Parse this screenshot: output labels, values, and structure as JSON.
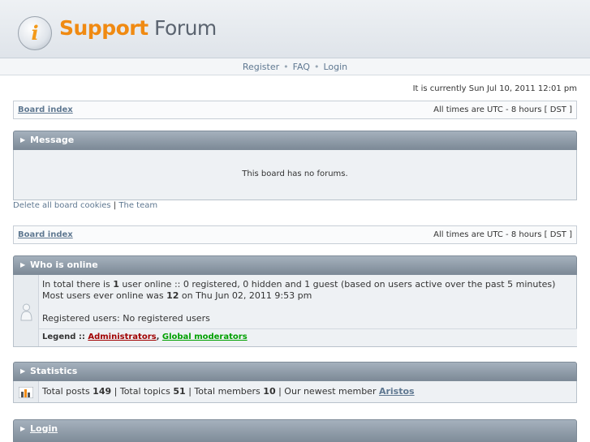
{
  "logo": {
    "icon_letter": "i",
    "name_part1": "Support",
    "name_part2": "Forum"
  },
  "nav": {
    "register": "Register",
    "faq": "FAQ",
    "login": "Login",
    "separator": "•"
  },
  "current_time": "It is currently Sun Jul 10, 2011 12:01 pm",
  "breadcrumb": {
    "board_index": "Board index",
    "timezone": "All times are UTC - 8 hours [ DST ]"
  },
  "message": {
    "title": "Message",
    "text": "This board has no forums."
  },
  "links": {
    "delete_cookies": "Delete all board cookies",
    "separator": "|",
    "the_team": "The team"
  },
  "who_is_online": {
    "title": "Who is online",
    "p1": "In total there is ",
    "count": "1",
    "p2": " user online :: 0 registered, 0 hidden and 1 guest (based on users active over the past 5 minutes)",
    "most_p1": "Most users ever online was ",
    "most_count": "12",
    "most_p2": " on Thu Jun 02, 2011 9:53 pm",
    "registered": "Registered users: No registered users",
    "legend_label": "Legend :: ",
    "admins": "Administrators",
    "comma": ", ",
    "gmods": "Global moderators"
  },
  "statistics": {
    "title": "Statistics",
    "t1": "Total posts ",
    "posts": "149",
    "t2": " | Total topics ",
    "topics": "51",
    "t3": " | Total members ",
    "members": "10",
    "t4": " | Our newest member ",
    "newest": "Aristos"
  },
  "login": {
    "title": "Login"
  },
  "colors": {
    "accent": "#f08a12",
    "link": "#5f7891",
    "admin": "#a00000",
    "gmod": "#00a000"
  },
  "icons": {
    "panel_arrow": "▶"
  }
}
